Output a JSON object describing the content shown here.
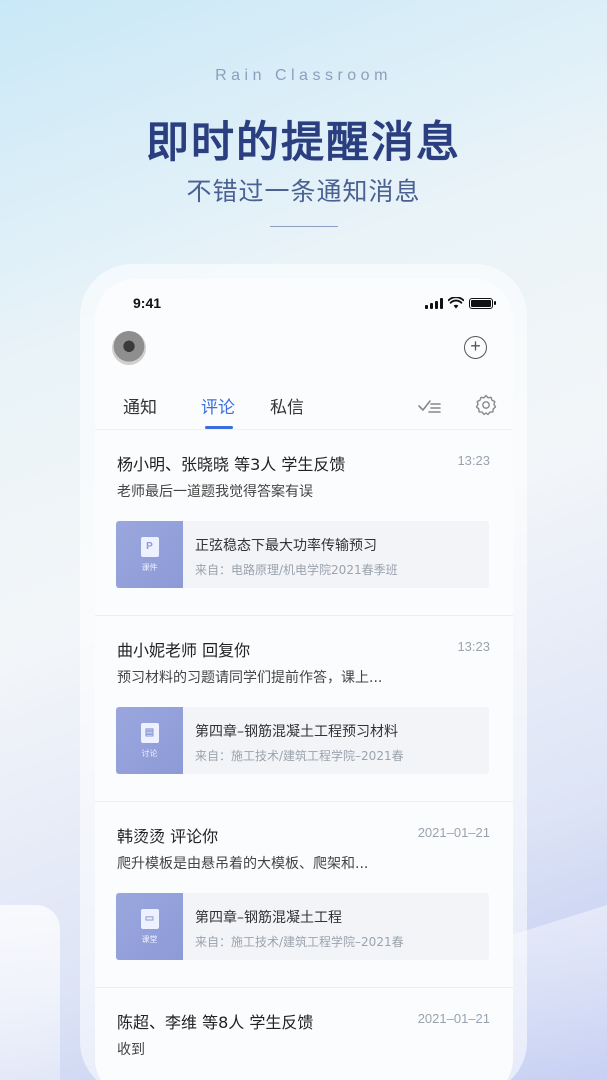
{
  "promo": {
    "brand": "Rain Classroom",
    "headline": "即时的提醒消息",
    "subline": "不错过一条通知消息"
  },
  "status_bar": {
    "time": "9:41"
  },
  "header": {
    "add_icon": "plus-circle-icon"
  },
  "tabs": [
    {
      "label": "通知",
      "active": false
    },
    {
      "label": "评论",
      "active": true
    },
    {
      "label": "私信",
      "active": false
    }
  ],
  "tab_actions": {
    "mark_read_icon": "check-list-icon",
    "settings_icon": "gear-icon"
  },
  "accent_color": "#3b6fe0",
  "messages": [
    {
      "title": "杨小明、张晓晓 等3人 学生反馈",
      "time": "13:23",
      "body": "老师最后一道题我觉得答案有误",
      "card": {
        "thumb_glyph": "P",
        "thumb_label": "课件",
        "title": "正弦稳态下最大功率传输预习",
        "source": "来自：电路原理/机电学院2021春季班"
      }
    },
    {
      "title": "曲小妮老师 回复你",
      "time": "13:23",
      "body": "预习材料的习题请同学们提前作答，课上...",
      "card": {
        "thumb_glyph": "▤",
        "thumb_label": "讨论",
        "title": "第四章–钢筋混凝土工程预习材料",
        "source": "来自：施工技术/建筑工程学院–2021春"
      }
    },
    {
      "title": "韩烫烫 评论你",
      "time": "2021–01–21",
      "body": "爬升模板是由悬吊着的大模板、爬架和...",
      "card": {
        "thumb_glyph": "▭",
        "thumb_label": "课堂",
        "title": "第四章–钢筋混凝土工程",
        "source": "来自：施工技术/建筑工程学院–2021春"
      }
    },
    {
      "title": "陈超、李维 等8人 学生反馈",
      "time": "2021–01–21",
      "body": "收到"
    }
  ]
}
